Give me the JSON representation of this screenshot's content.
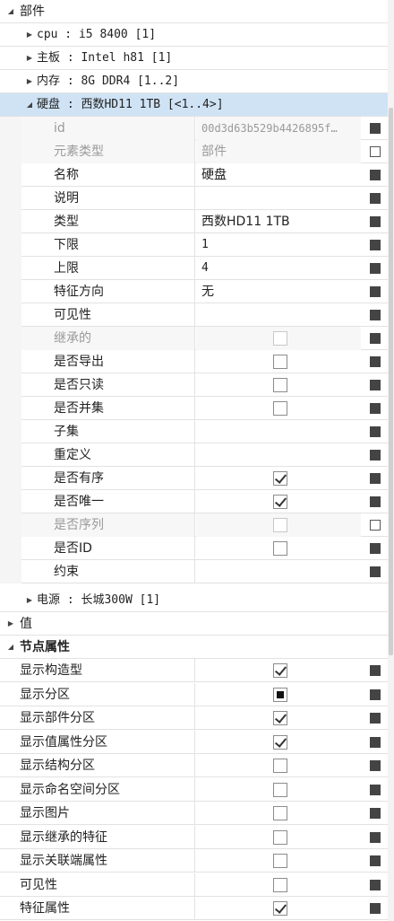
{
  "tree": {
    "section_parts": "部件",
    "cpu": "cpu : i5 8400 [1]",
    "motherboard": "主板 : Intel h81 [1]",
    "memory": "内存 : 8G DDR4 [1..2]",
    "disk": "硬盘 : 西数HD11 1TB [<1..4>]",
    "power": "电源 : 长城300W [1]",
    "section_value": "值",
    "section_node": "节点属性"
  },
  "disk_props": [
    {
      "name": "id",
      "value": "00d3d63b529b4426895f…",
      "kind": "text",
      "disabled": true,
      "marker": "filled"
    },
    {
      "name": "元素类型",
      "value": "部件",
      "kind": "text",
      "disabled": true,
      "marker": "hollow"
    },
    {
      "name": "名称",
      "value": "硬盘",
      "kind": "text",
      "disabled": false,
      "marker": "filled"
    },
    {
      "name": "说明",
      "value": "",
      "kind": "text",
      "disabled": false,
      "marker": "filled"
    },
    {
      "name": "类型",
      "value": "西数HD11 1TB",
      "kind": "text",
      "disabled": false,
      "marker": "filled"
    },
    {
      "name": "下限",
      "value": "1",
      "kind": "text",
      "disabled": false,
      "marker": "filled"
    },
    {
      "name": "上限",
      "value": "4",
      "kind": "text",
      "disabled": false,
      "marker": "filled"
    },
    {
      "name": "特征方向",
      "value": "无",
      "kind": "text",
      "disabled": false,
      "marker": "filled"
    },
    {
      "name": "可见性",
      "value": "",
      "kind": "text",
      "disabled": false,
      "marker": "filled"
    },
    {
      "name": "继承的",
      "value": false,
      "kind": "check",
      "disabled": true,
      "marker": "filled"
    },
    {
      "name": "是否导出",
      "value": false,
      "kind": "check",
      "disabled": false,
      "marker": "filled"
    },
    {
      "name": "是否只读",
      "value": false,
      "kind": "check",
      "disabled": false,
      "marker": "filled"
    },
    {
      "name": "是否并集",
      "value": false,
      "kind": "check",
      "disabled": false,
      "marker": "filled"
    },
    {
      "name": "子集",
      "value": "",
      "kind": "text",
      "disabled": false,
      "marker": "filled"
    },
    {
      "name": "重定义",
      "value": "",
      "kind": "text",
      "disabled": false,
      "marker": "filled"
    },
    {
      "name": "是否有序",
      "value": true,
      "kind": "check",
      "disabled": false,
      "marker": "filled"
    },
    {
      "name": "是否唯一",
      "value": true,
      "kind": "check",
      "disabled": false,
      "marker": "filled"
    },
    {
      "name": "是否序列",
      "value": false,
      "kind": "check",
      "disabled": true,
      "marker": "hollow"
    },
    {
      "name": "是否ID",
      "value": false,
      "kind": "check",
      "disabled": false,
      "marker": "filled"
    },
    {
      "name": "约束",
      "value": "",
      "kind": "text",
      "disabled": false,
      "marker": "filled"
    }
  ],
  "node_props": [
    {
      "name": "显示构造型",
      "state": "checked"
    },
    {
      "name": "显示分区",
      "state": "indeterminate"
    },
    {
      "name": "显示部件分区",
      "state": "checked"
    },
    {
      "name": "显示值属性分区",
      "state": "checked"
    },
    {
      "name": "显示结构分区",
      "state": "unchecked"
    },
    {
      "name": "显示命名空间分区",
      "state": "unchecked"
    },
    {
      "name": "显示图片",
      "state": "unchecked"
    },
    {
      "name": "显示继承的特征",
      "state": "unchecked"
    },
    {
      "name": "显示关联端属性",
      "state": "unchecked"
    },
    {
      "name": "可见性",
      "state": "unchecked"
    },
    {
      "name": "特征属性",
      "state": "checked"
    }
  ]
}
